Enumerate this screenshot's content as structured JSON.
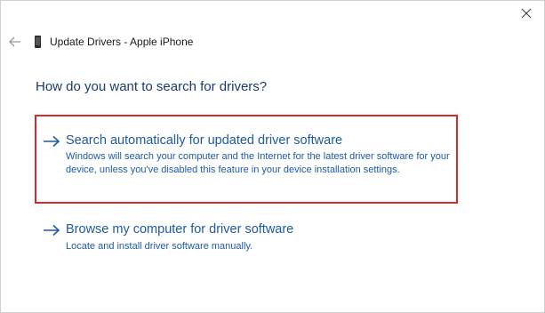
{
  "window": {
    "title": "Update Drivers - Apple iPhone"
  },
  "heading": "How do you want to search for drivers?",
  "options": [
    {
      "title": "Search automatically for updated driver software",
      "description": "Windows will search your computer and the Internet for the latest driver software for your device, unless you've disabled this feature in your device installation settings.",
      "highlighted": true
    },
    {
      "title": "Browse my computer for driver software",
      "description": "Locate and install driver software manually.",
      "highlighted": false
    }
  ],
  "icons": {
    "close": "close-icon",
    "back": "back-arrow-icon",
    "device": "phone-icon",
    "option_arrow": "right-arrow-icon"
  },
  "colors": {
    "link": "#1d5a9e",
    "heading": "#1c3b6b",
    "highlight_border": "#d42a2a"
  }
}
